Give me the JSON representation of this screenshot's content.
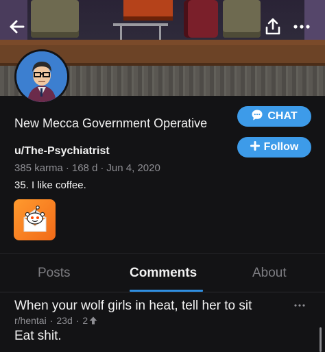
{
  "header": {
    "back_icon": "back-arrow-icon",
    "share_icon": "share-upload-icon",
    "more_icon": "more-horizontal-icon"
  },
  "profile": {
    "display_name": "New Mecca Government Operative",
    "username": "u/The-Psychiatrist",
    "karma": "385 karma",
    "age": "168 d",
    "join_date": "Jun 4, 2020",
    "bio": "35. I like coffee."
  },
  "buttons": {
    "chat_label": "CHAT",
    "follow_label": "Follow"
  },
  "colors": {
    "accent_blue": "#3d9be9",
    "tab_underline": "#2f8ee0",
    "background": "#131315",
    "trophy_orange": "#f26a18"
  },
  "tabs": [
    {
      "label": "Posts",
      "active": false
    },
    {
      "label": "Comments",
      "active": true
    },
    {
      "label": "About",
      "active": false
    }
  ],
  "comments": [
    {
      "post_title": "When your wolf girls in heat, tell her to sit",
      "subreddit": "r/hentai",
      "age": "23d",
      "score": "2",
      "body": "Eat shit."
    }
  ]
}
